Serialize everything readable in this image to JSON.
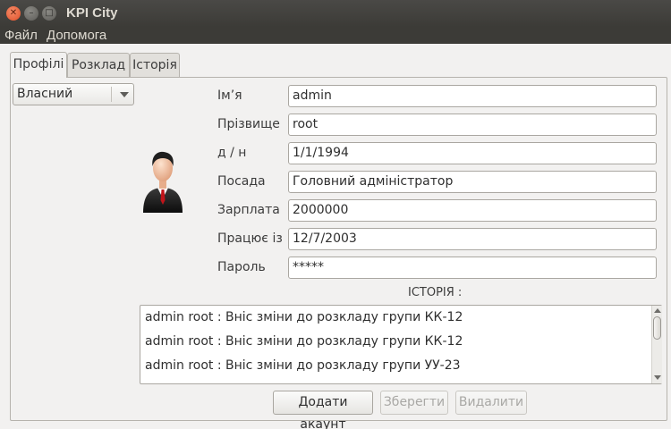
{
  "window": {
    "title": "KPI City"
  },
  "menubar": {
    "items": [
      "Файл",
      "Допомога"
    ]
  },
  "tabs": [
    {
      "label": "Профілі",
      "active": true
    },
    {
      "label": "Розклад",
      "active": false
    },
    {
      "label": "Історія",
      "active": false
    }
  ],
  "profile": {
    "selector_value": "Власний",
    "avatar_icon": "user-avatar-icon",
    "fields": [
      {
        "label": "Ім’я",
        "value": "admin"
      },
      {
        "label": "Прізвище",
        "value": "root"
      },
      {
        "label": "д / н",
        "value": "1/1/1994"
      },
      {
        "label": "Посада",
        "value": "Головний адміністратор"
      },
      {
        "label": "Зарплата",
        "value": "2000000"
      },
      {
        "label": "Працює із",
        "value": "12/7/2003"
      },
      {
        "label": "Пароль",
        "value": "*****"
      }
    ]
  },
  "history": {
    "title": "ІСТОРІЯ :",
    "rows": [
      "admin root : Вніс зміни до розкладу групи КК-12",
      "admin root : Вніс зміни до розкладу групи КК-12",
      "admin root : Вніс зміни до розкладу групи УУ-23"
    ]
  },
  "buttons": {
    "add": "Додати акаунт",
    "save": "Зберегти",
    "delete": "Видалити"
  },
  "colors": {
    "titlebar": "#3c3b37",
    "close_button": "#e0502a",
    "window_bg": "#f2f1f0"
  }
}
